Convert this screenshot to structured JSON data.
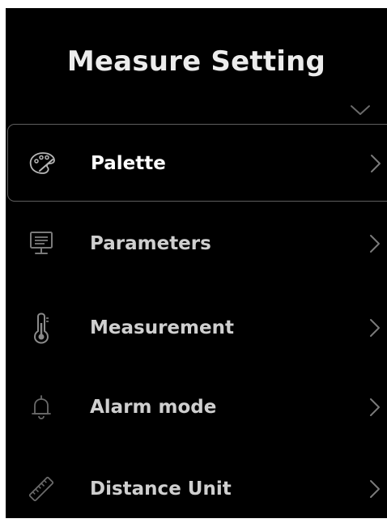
{
  "header": {
    "title": "Measure Setting",
    "collapse_icon": "chevron-down-icon"
  },
  "menu": {
    "items": [
      {
        "label": "Palette",
        "icon": "palette-icon",
        "selected": true
      },
      {
        "label": "Parameters",
        "icon": "monitor-icon",
        "selected": false
      },
      {
        "label": "Measurement",
        "icon": "thermometer-icon",
        "selected": false
      },
      {
        "label": "Alarm mode",
        "icon": "bell-icon",
        "selected": false
      },
      {
        "label": "Distance Unit",
        "icon": "ruler-icon",
        "selected": false
      }
    ]
  },
  "colors": {
    "background": "#000000",
    "text": "#ffffff",
    "muted_text": "#cfcfcf",
    "icon": "#7a7a7a",
    "selected_border": "#5e5e5e"
  }
}
